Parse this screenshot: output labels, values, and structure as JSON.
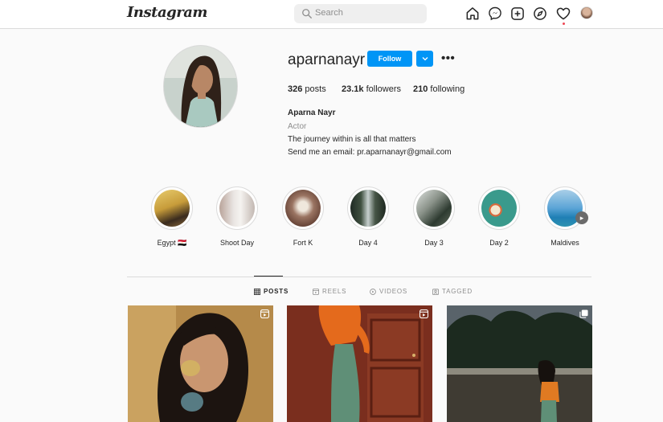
{
  "brand": "Instagram",
  "search": {
    "placeholder": "Search"
  },
  "nav_icons": [
    "home-icon",
    "messenger-icon",
    "new-post-icon",
    "explore-icon",
    "activity-heart-icon",
    "profile-avatar"
  ],
  "profile": {
    "username": "aparnanayr",
    "follow_label": "Follow",
    "more_label": "•••",
    "stats": {
      "posts_count": "326",
      "posts_label": "posts",
      "followers_count": "23.1k",
      "followers_label": "followers",
      "following_count": "210",
      "following_label": "following"
    },
    "name": "Aparna Nayr",
    "category": "Actor",
    "bio_line1": "The journey within is all that matters",
    "bio_line2": "Send me an email: pr.aparnanayr@gmail.com"
  },
  "highlights": [
    {
      "label": "Egypt 🇪🇬"
    },
    {
      "label": "Shoot Day"
    },
    {
      "label": "Fort K"
    },
    {
      "label": "Day 4"
    },
    {
      "label": "Day 3"
    },
    {
      "label": "Day 2"
    },
    {
      "label": "Maldives"
    }
  ],
  "tabs": [
    {
      "label": "POSTS",
      "active": true,
      "icon": "grid-icon"
    },
    {
      "label": "REELS",
      "active": false,
      "icon": "reels-icon"
    },
    {
      "label": "VIDEOS",
      "active": false,
      "icon": "video-icon"
    },
    {
      "label": "TAGGED",
      "active": false,
      "icon": "tagged-icon"
    }
  ],
  "posts": [
    {
      "type": "reel",
      "badge_icon": "reel-badge-icon"
    },
    {
      "type": "reel",
      "badge_icon": "reel-badge-icon"
    },
    {
      "type": "carousel",
      "badge_icon": "carousel-badge-icon"
    }
  ],
  "colors": {
    "accent": "#0095f6",
    "notification": "#ed4956",
    "border": "#dbdbdb"
  }
}
